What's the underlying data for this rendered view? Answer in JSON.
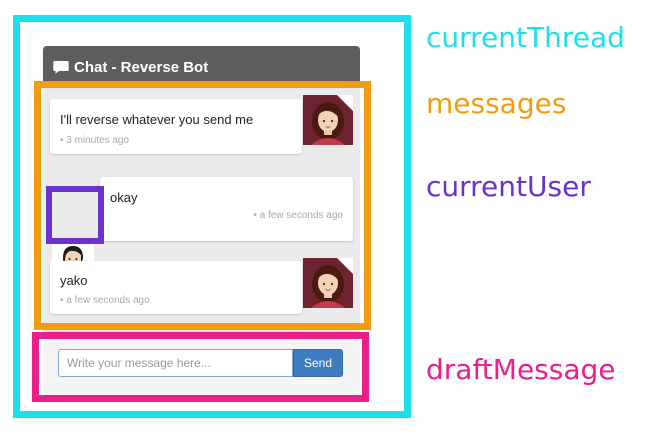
{
  "chat": {
    "title": "Chat - Reverse Bot",
    "icon": "chat-bubble-icon",
    "messages": [
      {
        "text": "I'll reverse whatever you send me",
        "time": "• 3 minutes ago",
        "sender": "bot",
        "avatar": "bot-avatar-icon"
      },
      {
        "text": "okay",
        "time": "• a few seconds ago",
        "sender": "user",
        "avatar": "user-avatar-icon"
      },
      {
        "text": "yako",
        "time": "• a few seconds ago",
        "sender": "bot",
        "avatar": "bot-avatar-icon"
      }
    ],
    "compose": {
      "placeholder": "Write your message here...",
      "value": "",
      "send_label": "Send"
    }
  },
  "annotations": [
    {
      "label": "currentThread",
      "color": "#1ee0ec"
    },
    {
      "label": "messages",
      "color": "#f39c12"
    },
    {
      "label": "currentUser",
      "color": "#6a33cc"
    },
    {
      "label": "draftMessage",
      "color": "#ec1e8c"
    }
  ],
  "colors": {
    "header_bg": "#5e5e5e",
    "panel_bg": "#ebebeb",
    "send_button": "#3f7bc0"
  }
}
